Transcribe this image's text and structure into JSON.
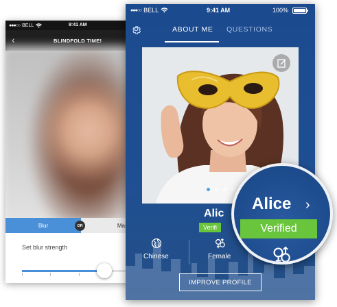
{
  "back_screen": {
    "status": {
      "carrier": "BELL",
      "time": "9:41 AM"
    },
    "nav": {
      "title": "BLINDFOLD TIME!"
    },
    "segmented": {
      "blur_label": "Blur",
      "or_label": "OR",
      "mask_label": "Mask",
      "selected": "Blur"
    },
    "settings": {
      "label": "Set blur strength",
      "strength": 0.72
    }
  },
  "front_screen": {
    "status": {
      "carrier": "BELL",
      "time": "9:41 AM",
      "battery": "100%"
    },
    "tabs": [
      {
        "label": "ABOUT ME",
        "active": true
      },
      {
        "label": "QUESTIONS",
        "active": false
      }
    ],
    "photo": {
      "page_count": 4,
      "active_page": 1
    },
    "profile": {
      "name_partial": "Alic",
      "verified_partial": "Verifi"
    },
    "attributes": [
      {
        "icon": "globe-icon",
        "label": "Chinese"
      },
      {
        "icon": "gender-icon",
        "label": "Female"
      }
    ],
    "improve_button": "IMPROVE PROFILE"
  },
  "magnifier": {
    "name": "Alice",
    "chevron": "›",
    "verified": "Verified",
    "icon": "gender-icon"
  },
  "colors": {
    "accent_blue": "#4a90d9",
    "app_bg": "#1f4f93",
    "verified_green": "#69c53c",
    "mask_gold": "#e8bd2e"
  }
}
